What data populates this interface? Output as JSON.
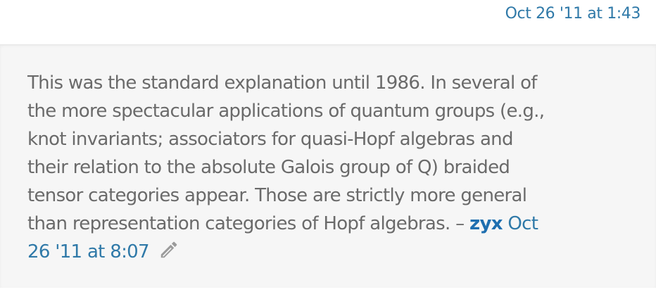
{
  "top_comment": {
    "timestamp": "Oct 26 '11 at 1:43"
  },
  "comment": {
    "lines": [
      "This was the standard explanation until 1986. In several of",
      "the more spectacular applications of quantum groups (e.g.,",
      "knot invariants; associators for quasi-Hopf algebras and",
      "their relation to the absolute Galois group of Q) braided",
      "tensor categories appear. Those are strictly more general",
      "than representation categories of Hopf algebras."
    ],
    "separator": "–",
    "author": "zyx",
    "date_part1": "Oct",
    "date_part2": "26 '11 at 8:07",
    "edit_icon": "pencil-icon",
    "colors": {
      "text": "#6a6a6a",
      "link": "#2f79a8",
      "author": "#1f6fb0",
      "background": "#f6f6f6"
    }
  }
}
